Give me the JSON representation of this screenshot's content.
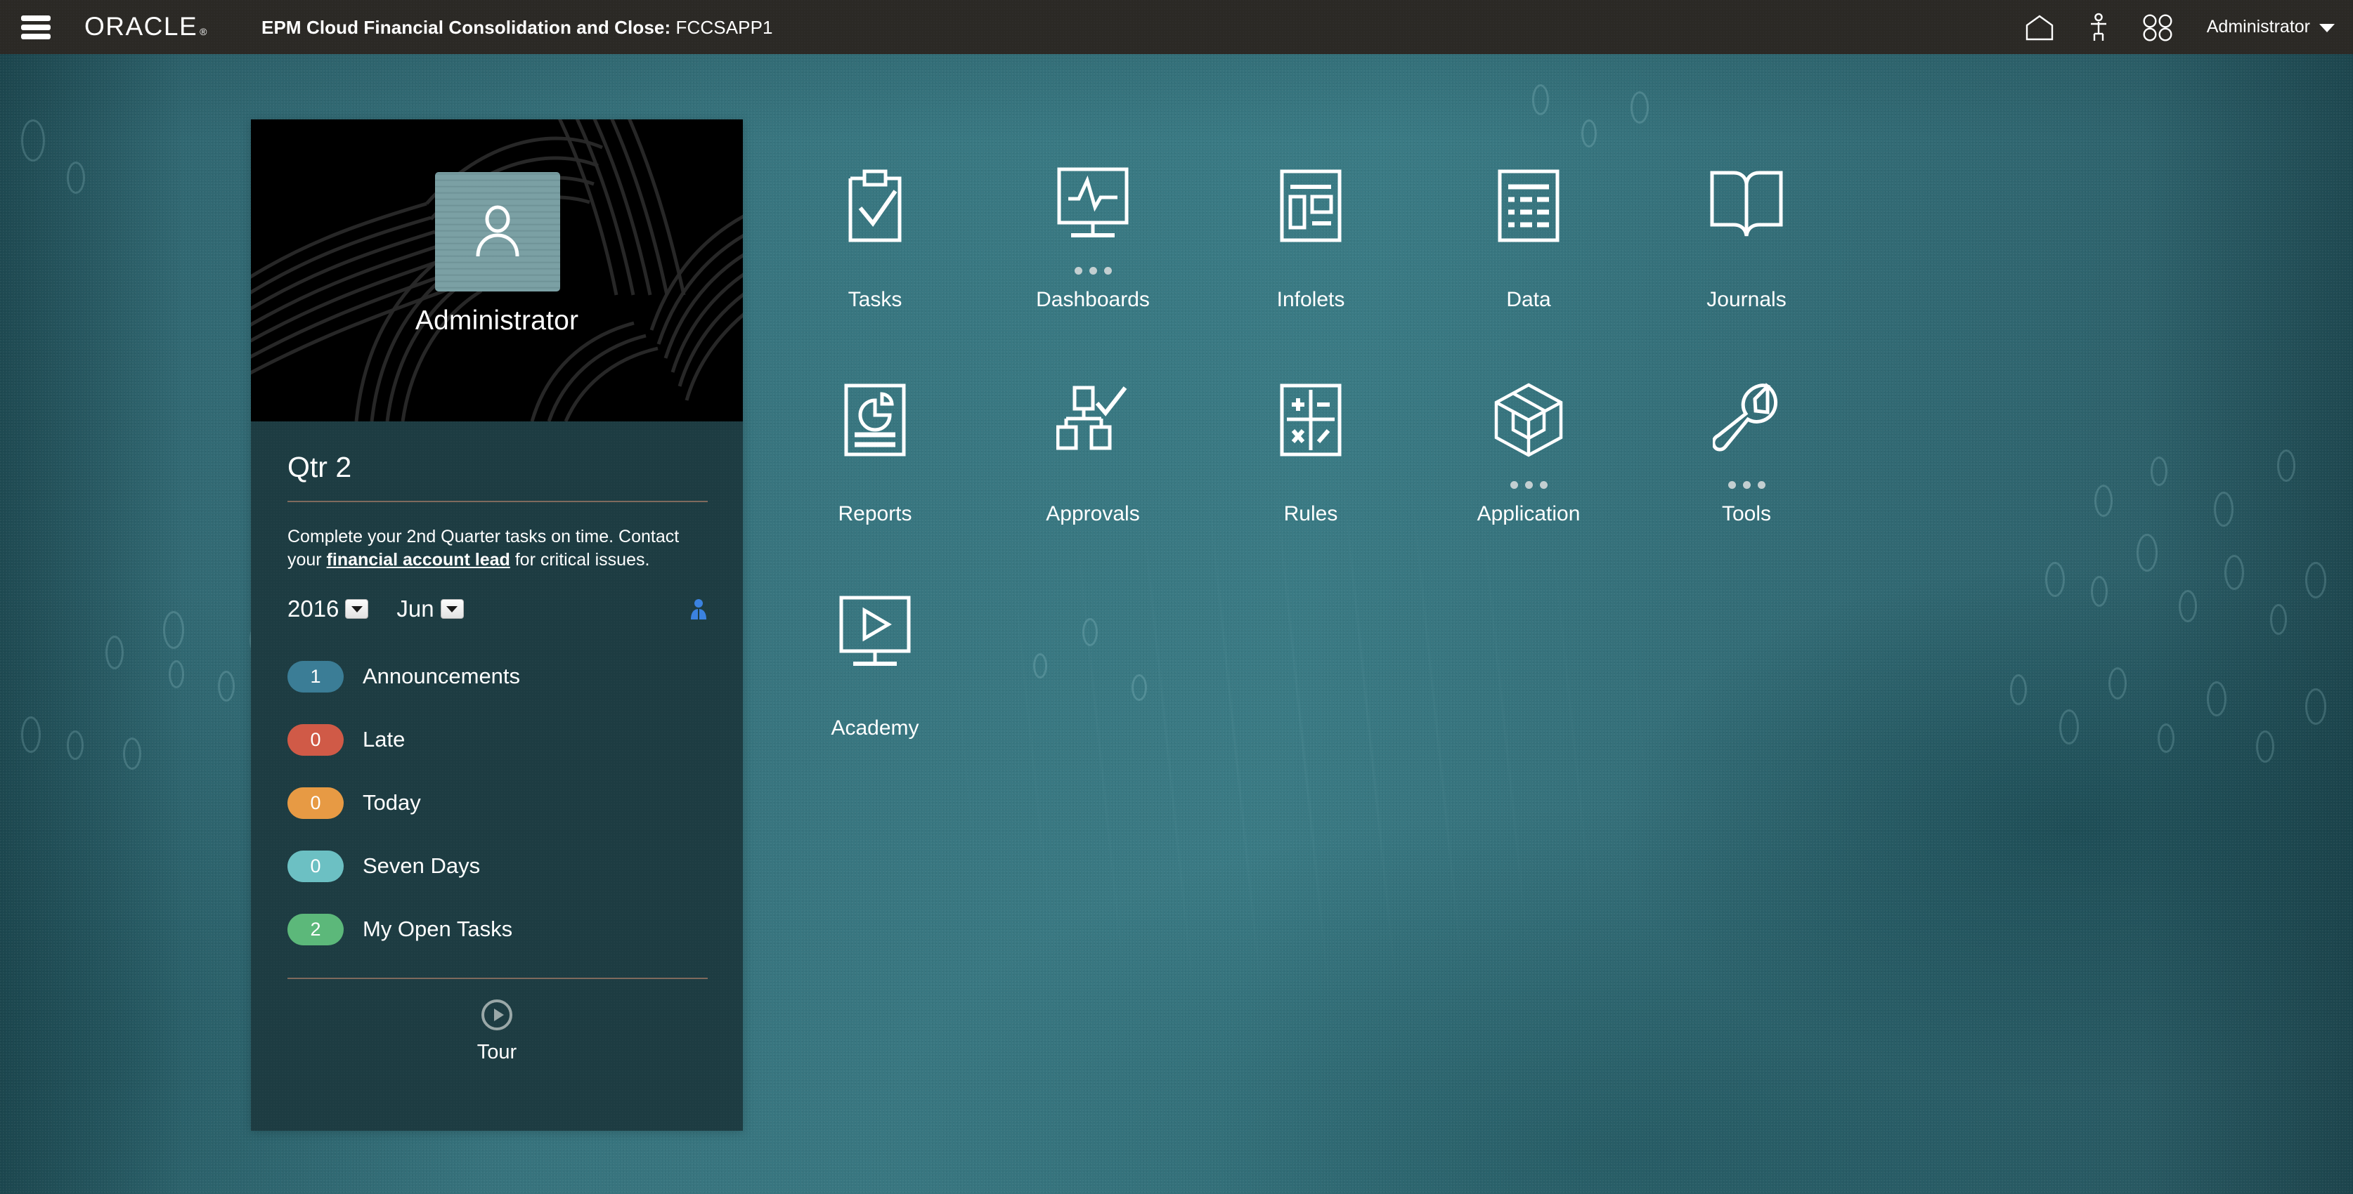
{
  "topbar": {
    "menu_icon": "hamburger-icon",
    "logo_text": "ORACLE",
    "logo_tm": "®",
    "app_title_bold": "EPM Cloud Financial Consolidation and Close:",
    "app_title_thin": " FCCSAPP1",
    "icons": [
      {
        "name": "home-icon",
        "label": "Home"
      },
      {
        "name": "accessibility-icon",
        "label": "Accessibility"
      },
      {
        "name": "navigator-icon",
        "label": "Navigator"
      }
    ],
    "user_name": "Administrator",
    "user_caret": "chevron-down-icon"
  },
  "welcome_card": {
    "avatar_icon": "user-avatar-icon",
    "avatar_name": "Administrator",
    "quarter_title": "Qtr 2",
    "announcement_prefix": "Complete your 2nd Quarter tasks on time. Contact your ",
    "announcement_link": "financial account lead",
    "announcement_suffix": " for critical issues.",
    "year_value": "2016",
    "month_value": "Jun",
    "person_filter_icon": "person-filter-icon",
    "status_items": [
      {
        "count": "1",
        "label": "Announcements",
        "color": "#3b7d96"
      },
      {
        "count": "0",
        "label": "Late",
        "color": "#d05a47"
      },
      {
        "count": "0",
        "label": "Today",
        "color": "#e79a44"
      },
      {
        "count": "0",
        "label": "Seven Days",
        "color": "#6cc0c3"
      },
      {
        "count": "2",
        "label": "My Open Tasks",
        "color": "#5cb87a"
      }
    ],
    "tour_icon": "play-circle-icon",
    "tour_label": "Tour"
  },
  "icon_grid": {
    "tiles": [
      {
        "label": "Tasks",
        "icon": "clipboard-check-icon",
        "dots": false
      },
      {
        "label": "Dashboards",
        "icon": "dashboard-monitor-icon",
        "dots": true
      },
      {
        "label": "Infolets",
        "icon": "infolets-layout-icon",
        "dots": false
      },
      {
        "label": "Data",
        "icon": "data-document-icon",
        "dots": false
      },
      {
        "label": "Journals",
        "icon": "open-book-icon",
        "dots": false
      },
      {
        "label": "Reports",
        "icon": "report-piechart-icon",
        "dots": false
      },
      {
        "label": "Approvals",
        "icon": "approvals-orgchart-check-icon",
        "dots": false
      },
      {
        "label": "Rules",
        "icon": "rules-calculator-icon",
        "dots": false
      },
      {
        "label": "Application",
        "icon": "application-cube-icon",
        "dots": true
      },
      {
        "label": "Tools",
        "icon": "tools-wrench-icon",
        "dots": true
      },
      {
        "label": "Academy",
        "icon": "academy-play-monitor-icon",
        "dots": false
      }
    ]
  },
  "colors": {
    "background_teal": "#35707a",
    "topbar_dark": "#2b2925",
    "card_body": "#1d3c42",
    "card_avatar_bg": "#000000",
    "avatar_tile": "#7ba0a4",
    "divider": "#7f6a5d"
  }
}
